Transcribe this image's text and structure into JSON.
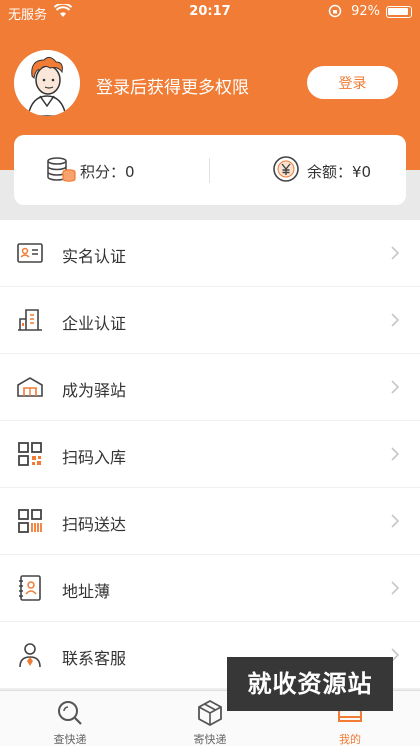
{
  "status_bar": {
    "carrier": "无服务",
    "time": "20:17",
    "battery": "92%"
  },
  "profile": {
    "login_prompt": "登录后获得更多权限",
    "login_button": "登录"
  },
  "stats": {
    "points": "积分：0",
    "balance": "余额：¥0"
  },
  "menu": {
    "items": [
      {
        "label": "实名认证",
        "icon": "id-card-icon"
      },
      {
        "label": "企业认证",
        "icon": "building-icon"
      },
      {
        "label": "成为驿站",
        "icon": "station-icon"
      },
      {
        "label": "扫码入库",
        "icon": "qr-code-icon"
      },
      {
        "label": "扫码送达",
        "icon": "barcode-icon"
      },
      {
        "label": "地址薄",
        "icon": "address-book-icon"
      },
      {
        "label": "联系客服",
        "icon": "customer-service-icon"
      }
    ]
  },
  "watermark": "就收资源站",
  "tabs": [
    {
      "label": "查快递",
      "icon": "search-icon",
      "active": false
    },
    {
      "label": "寄快递",
      "icon": "package-icon",
      "active": false
    },
    {
      "label": "我的",
      "icon": "profile-icon",
      "active": true
    }
  ],
  "colors": {
    "accent": "#f07c35"
  }
}
